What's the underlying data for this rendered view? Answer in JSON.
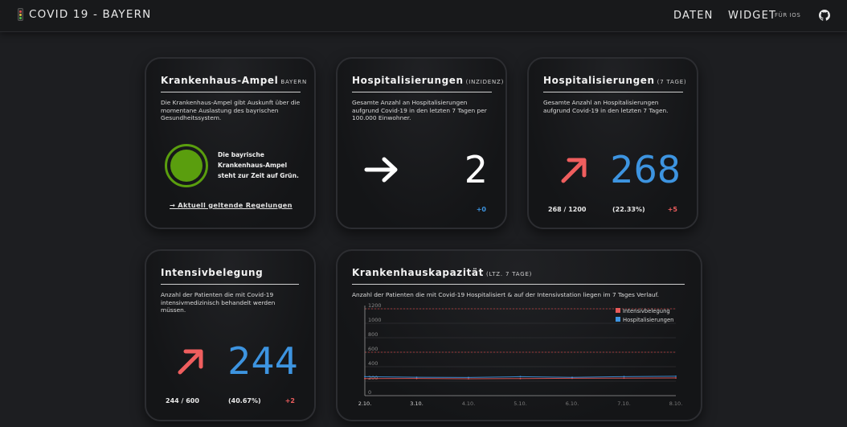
{
  "header": {
    "title": "COVID 19 - BAYERN",
    "nav": {
      "daten": "DATEN",
      "widget": "WIDGET",
      "widget_sub": "FÜR IOS"
    }
  },
  "colors": {
    "green": "#5a9e0e",
    "blue": "#3d94e0",
    "red": "#e85a5a",
    "trend_red": "#ef5e5e"
  },
  "ampel": {
    "title": "Krankenhaus-Ampel",
    "title_sub": "BAYERN",
    "desc": "Die Krankenhaus-Ampel gibt Auskunft über die momentane Auslastung des bayrischen Gesundheitssystem.",
    "status_text": "Die bayrische Krankenhaus-Ampel steht zur Zeit auf Grün.",
    "link": "→ Aktuell geltende Regelungen",
    "light_icon": "green-traffic-light-icon"
  },
  "inzidenz": {
    "title": "Hospitalisierungen",
    "title_sub": "(INZIDENZ)",
    "desc": "Gesamte Anzahl an Hospitalisierungen aufgrund Covid-19 in den letzten 7 Tagen per 100.000 Einwohner.",
    "trend_icon": "arrow-right-icon",
    "value": "2",
    "change": "+0"
  },
  "hosp7": {
    "title": "Hospitalisierungen",
    "title_sub": "(7 TAGE)",
    "desc": "Gesamte Anzahl an Hospitalisierungen aufgrund Covid-19 in den letzten 7 Tagen.",
    "trend_icon": "arrow-up-right-icon",
    "value": "268",
    "ratio": "268 / 1200",
    "percent": "(22.33%)",
    "change": "+5"
  },
  "intensiv": {
    "title": "Intensivbelegung",
    "desc": "Anzahl der Patienten die mit Covid-19 intensivmedizinisch behandelt werden müssen.",
    "trend_icon": "arrow-up-right-icon",
    "value": "244",
    "ratio": "244 / 600",
    "percent": "(40.67%)",
    "change": "+2"
  },
  "kapazitaet": {
    "title": "Krankenhauskapazität",
    "title_sub": "(LTZ. 7 TAGE)",
    "desc": "Anzahl der Patienten die mit Covid-19 Hospitalisiert & auf der Intensivstation liegen im 7 Tages Verlauf."
  },
  "chart_data": {
    "type": "line",
    "x": [
      "2.10.",
      "3.10.",
      "4.10.",
      "5.10.",
      "6.10.",
      "7.10.",
      "8.10."
    ],
    "ylim": [
      0,
      1200
    ],
    "yticks": [
      "0",
      "200",
      "400",
      "600",
      "800",
      "1000",
      "1200"
    ],
    "series": [
      {
        "name": "Intensivbelegung",
        "color": "#e85a5a",
        "values": [
          236,
          237,
          233,
          236,
          240,
          242,
          244
        ]
      },
      {
        "name": "Hospitalisierungen",
        "color": "#3d94e0",
        "values": [
          262,
          254,
          251,
          262,
          253,
          263,
          268
        ]
      }
    ],
    "threshold_lines": [
      {
        "value": 1200,
        "color": "#c04040"
      },
      {
        "value": 600,
        "color": "#c04040"
      }
    ],
    "legend_position": "top-right",
    "grid": true
  }
}
